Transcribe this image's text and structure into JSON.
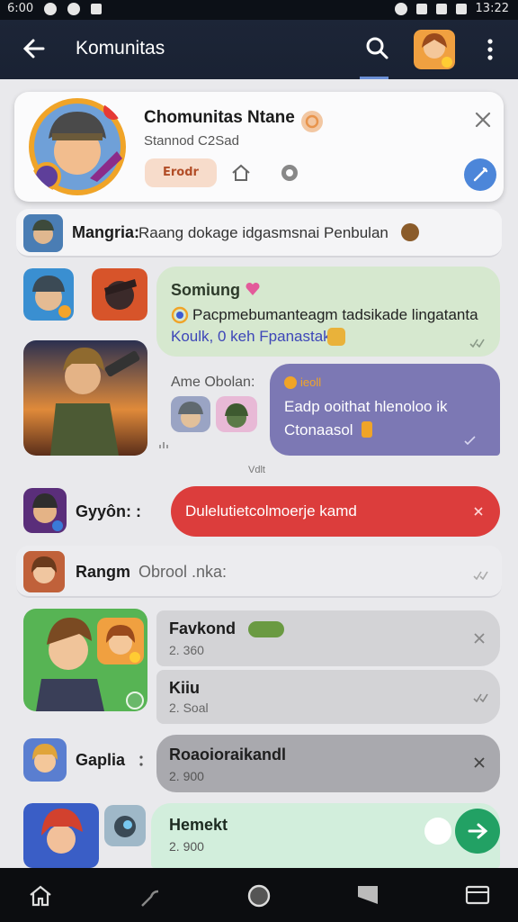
{
  "status_bar": {
    "time": "6:00",
    "clock": "13:22"
  },
  "app_bar": {
    "title": "Komunitas"
  },
  "community_card": {
    "name": "Chomunitas Ntane",
    "subtitle": "Stannod C2Sad",
    "button_label": "Erodr"
  },
  "pinned": {
    "sender": "Mangria:",
    "text": "Raang dokage idgasmsnai Penbulan"
  },
  "chat1": {
    "title": "Somiung",
    "line1": "Pacpmebumanteagm tadsikade lingatanta",
    "line2": "Koulk, 0 keh Fpanastak"
  },
  "chat2": {
    "prefix": "Ame Obolan:",
    "tag": "ieoll",
    "line1": "Eadp ooithat hlenoloo ik",
    "line2": "Ctonaasol",
    "time_label": "Vdlt"
  },
  "alert": {
    "sender": "Gyyôn: :",
    "text": "Dulelutietcolmoerje kamd"
  },
  "mention": {
    "sender": "Rangm",
    "text": "Obrool .nka:"
  },
  "list": [
    {
      "title": "Favkond",
      "subtitle": "2. 360"
    },
    {
      "title": "Kiiu",
      "subtitle": "2. Soal"
    }
  ],
  "gaprow": {
    "label": "Gaplia",
    "title": "Roaoioraikandl",
    "subtitle": "2. 900"
  },
  "last": {
    "title": "Hemekt",
    "subtitle": "2. 900"
  },
  "colors": {
    "appbar": "#1c2537",
    "accent_red": "#dc3d3c",
    "bubble_green": "#d6e8cf",
    "bubble_purple": "#7c78b4",
    "fab_green": "#22a164"
  }
}
